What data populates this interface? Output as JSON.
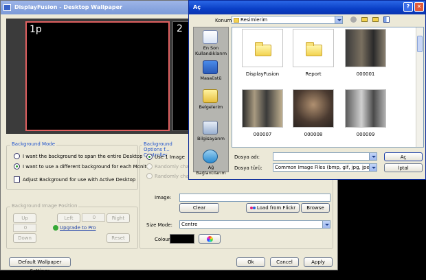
{
  "colors": {
    "accent": "#2255cc",
    "monitor_border": "#e06060",
    "title_active": "#0a3fc6"
  },
  "main_window": {
    "title": "DisplayFusion - Desktop Wallpaper",
    "monitor1_label": "1p",
    "monitor2_label": "2",
    "background_mode": {
      "title": "Background Mode",
      "option_span": "I want the background to span the entire Desktop",
      "option_different": "I want to use a different background for each Monitor",
      "check_active_desktop": "Adjust Background for use with Active Desktop"
    },
    "image_position": {
      "title": "Background Image Position",
      "up": "Up",
      "left": "Left",
      "right": "Right",
      "down": "Down",
      "reset": "Reset",
      "value1": "0",
      "value2": "0",
      "upgrade_link": "Upgrade to Pro"
    },
    "options": {
      "title": "Background Options f... Controller",
      "use_one": "Use 1 Image",
      "random1": "Randomly chan...",
      "random2": "Randomly chan...",
      "image_label": "Image:",
      "clear": "Clear",
      "load_flickr": "Load from Flickr",
      "browse": "Browse",
      "size_mode_label": "Size Mode:",
      "size_mode_value": "Centre",
      "colour_label": "Colour:"
    },
    "footer": {
      "default_btn": "Default Wallpaper Settings",
      "ok": "Ok",
      "cancel": "Cancel",
      "apply": "Apply"
    }
  },
  "open_dialog": {
    "title": "Aç",
    "help": "?",
    "close": "✕",
    "location_label": "Konum:",
    "location_value": "Resimlerim",
    "places": [
      {
        "label": "En Son Kullandıklarım",
        "icon": "recent-documents-icon"
      },
      {
        "label": "Masaüstü",
        "icon": "desktop-icon"
      },
      {
        "label": "Belgelerim",
        "icon": "my-documents-icon"
      },
      {
        "label": "Bilgisayarım",
        "icon": "my-computer-icon"
      },
      {
        "label": "Ağ Bağlantılarım",
        "icon": "network-places-icon"
      }
    ],
    "items": [
      {
        "name": "DisplayFusion",
        "kind": "folder"
      },
      {
        "name": "Report",
        "kind": "folder"
      },
      {
        "name": "000001",
        "kind": "photo"
      },
      {
        "name": "000007",
        "kind": "photo"
      },
      {
        "name": "000008",
        "kind": "photo"
      },
      {
        "name": "000009",
        "kind": "photo"
      }
    ],
    "filename_label": "Dosya adı:",
    "filename_value": "",
    "filetype_label": "Dosya türü:",
    "filetype_value": "Common Image Files (bmp, gif, jpg, jpeg, png)",
    "open_btn": "Aç",
    "cancel_btn": "İptal"
  }
}
